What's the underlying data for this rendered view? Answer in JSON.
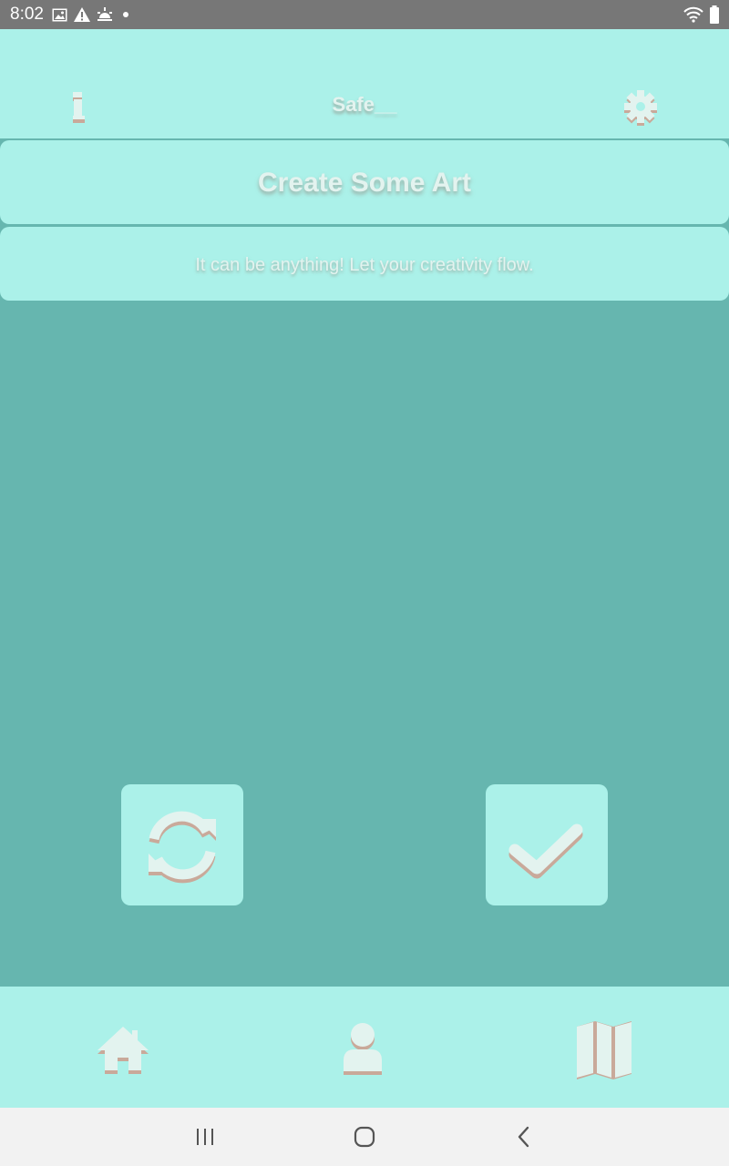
{
  "status_bar": {
    "time": "8:02",
    "left_icons": [
      "image-icon",
      "warning-icon",
      "weather-icon",
      "dot-icon"
    ],
    "right_icons": [
      "wifi-icon",
      "battery-icon"
    ]
  },
  "header": {
    "title": "Safe__",
    "info_icon": "info-icon",
    "settings_icon": "gear-icon"
  },
  "prompt": {
    "title": "Create Some Art",
    "subtitle": "It can be anything! Let your creativity flow."
  },
  "actions": {
    "refresh_icon": "refresh-icon",
    "confirm_icon": "check-icon"
  },
  "bottom_nav": {
    "items": [
      {
        "icon": "home-icon"
      },
      {
        "icon": "user-icon"
      },
      {
        "icon": "map-icon"
      }
    ]
  },
  "system_nav": {
    "items": [
      "recent-apps-icon",
      "home-circle-icon",
      "back-icon"
    ]
  },
  "colors": {
    "accent": "#abf1e9",
    "canvas": "#66b6af",
    "text": "#e3f3ef",
    "shadow": "#c9a99a",
    "status_bar": "#777777",
    "system_nav": "#f2f2f2"
  }
}
